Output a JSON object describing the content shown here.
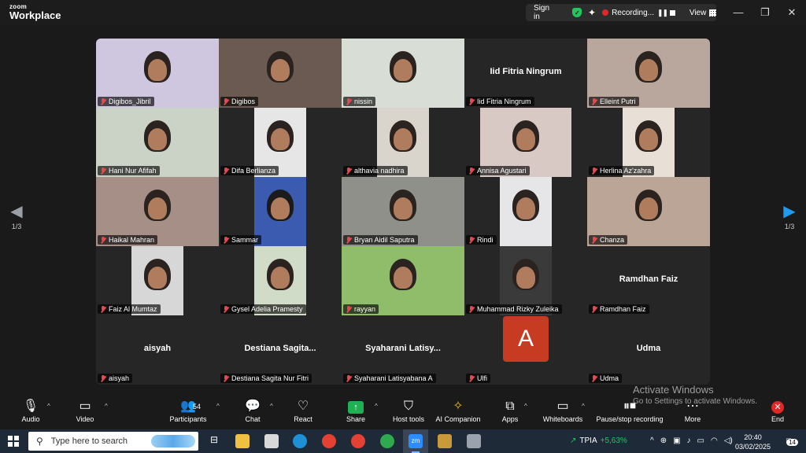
{
  "app": {
    "logo_top": "zoom",
    "logo_bottom": "Workplace"
  },
  "titlebar": {
    "signin": "Sign in",
    "recording": "Recording...",
    "view": "View",
    "minimize": "—",
    "restore": "❐",
    "close": "✕"
  },
  "pager": {
    "left_page": "1/3",
    "right_page": "1/3"
  },
  "tiles": [
    {
      "name": "Digibos_Jibril",
      "big": "",
      "bg": "#cfc6e0"
    },
    {
      "name": "Digibos",
      "big": "",
      "bg": "#6b5a52"
    },
    {
      "name": "nissin",
      "big": "",
      "bg": "#d8ddd5"
    },
    {
      "name": "Iid Fitria Ningrum",
      "big": "Iid Fitria Ningrum",
      "bg": ""
    },
    {
      "name": "Elleint Putri",
      "big": "",
      "bg": "#b9a79e"
    },
    {
      "name": "Hani Nur Afifah",
      "big": "",
      "bg": "#cbd3c6"
    },
    {
      "name": "Difa Berlianza",
      "big": "",
      "bg": "#e6e6e6"
    },
    {
      "name": "althavia nadhira",
      "big": "",
      "bg": "#d9d4cc"
    },
    {
      "name": "Annisa Agustari",
      "big": "",
      "bg": "#d8c9c4"
    },
    {
      "name": "Herlina Az'zahra",
      "big": "",
      "bg": "#e8e0d6"
    },
    {
      "name": "Haikal Mahran",
      "big": "",
      "bg": "#a58f86"
    },
    {
      "name": "Sammar",
      "big": "",
      "bg": "#3b5bb0"
    },
    {
      "name": "Bryan Aidil Saputra",
      "big": "",
      "bg": "#8f908a"
    },
    {
      "name": "Rindi",
      "big": "",
      "bg": "#e6e6e8"
    },
    {
      "name": "Chanza",
      "big": "",
      "bg": "#bba596"
    },
    {
      "name": "Faiz Al Mumtaz",
      "big": "",
      "bg": "#d7d7d7"
    },
    {
      "name": "Gysel Adelia Pramesty",
      "big": "",
      "bg": "#d0dcc8"
    },
    {
      "name": "rayyan",
      "big": "",
      "bg": "#8fbd6a"
    },
    {
      "name": "Muhammad Rizky Zuleika",
      "big": "",
      "bg": "#3a3a3a"
    },
    {
      "name": "Ramdhan Faiz",
      "big": "Ramdhan Faiz",
      "bg": ""
    },
    {
      "name": "aisyah",
      "big": "aisyah",
      "bg": ""
    },
    {
      "name": "Destiana Sagita Nur Fitri",
      "big": "Destiana  Sagita...",
      "bg": ""
    },
    {
      "name": "Syaharani Latisyabana A",
      "big": "Syaharani  Latisy...",
      "bg": ""
    },
    {
      "name": "Ulfi",
      "big": "",
      "bg": "",
      "avatar": "A"
    },
    {
      "name": "Udma",
      "big": "Udma",
      "bg": ""
    }
  ],
  "controls": {
    "audio": "Audio",
    "video": "Video",
    "participants": "Participants",
    "participants_count": "54",
    "chat": "Chat",
    "react": "React",
    "share": "Share",
    "host_tools": "Host tools",
    "ai_companion": "AI Companion",
    "apps": "Apps",
    "whiteboards": "Whiteboards",
    "pause_stop": "Pause/stop recording",
    "more": "More",
    "end": "End"
  },
  "watermark": {
    "line1": "Activate Windows",
    "line2": "Go to Settings to activate Windows."
  },
  "taskbar": {
    "search_placeholder": "Type here to search",
    "ticker_symbol": "TPIA",
    "ticker_change": "+5,63%",
    "time": "20:40",
    "date": "03/02/2025",
    "notifications": "14"
  },
  "colors": {
    "accent_green": "#2ec27e",
    "record_red": "#e02828",
    "muted_red": "#e5484d",
    "avatar_orange": "#c73b22",
    "share_green": "#1fb255"
  }
}
